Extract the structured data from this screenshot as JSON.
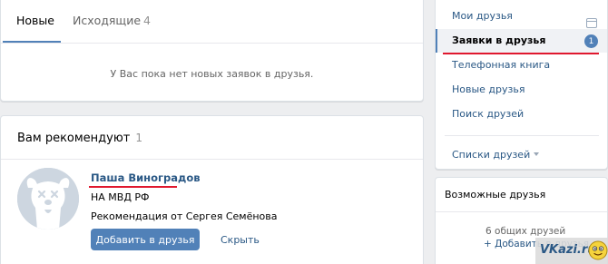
{
  "tabs": {
    "new_label": "Новые",
    "outgoing_label": "Исходящие",
    "outgoing_count": "4"
  },
  "requests": {
    "empty_text": "У Вас пока нет новых заявок в друзья."
  },
  "recommendations": {
    "title": "Вам рекомендуют",
    "count": "1",
    "person": {
      "name": "Паша Виноградов",
      "organization": "НА МВД РФ",
      "recommendation": "Рекомендация от Сергея Семёнова",
      "add_button": "Добавить в друзья",
      "hide_link": "Скрыть"
    }
  },
  "menu": {
    "items": [
      {
        "label": "Мои друзья"
      },
      {
        "label": "Заявки в друзья",
        "badge": "1"
      },
      {
        "label": "Телефонная книга"
      },
      {
        "label": "Новые друзья"
      },
      {
        "label": "Поиск друзей"
      },
      {
        "label": "Списки друзей"
      }
    ]
  },
  "possible": {
    "title": "Возможные друзья",
    "mutual": "6 общих друзей",
    "add": "+ Добавить в друзья"
  },
  "watermark": {
    "text": "VKazi.ru"
  },
  "colors": {
    "accent": "#5181b8",
    "link": "#2a5885",
    "highlight_line": "#e0182e",
    "background": "#edeef0"
  }
}
